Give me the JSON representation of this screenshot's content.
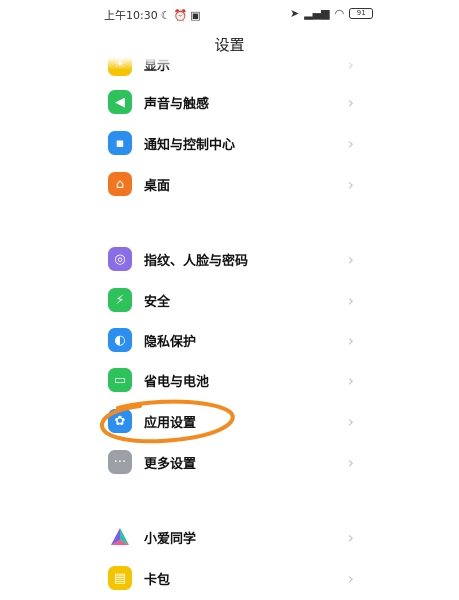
{
  "status": {
    "time": "上午10:30",
    "battery": "91"
  },
  "header": {
    "title": "设置"
  },
  "items": [
    {
      "label": "显示",
      "icon": "sun-icon",
      "color": "#f5c400"
    },
    {
      "label": "声音与触感",
      "icon": "speaker-icon",
      "color": "#2dc35a"
    },
    {
      "label": "通知与控制中心",
      "icon": "notification-icon",
      "color": "#2a8ff0"
    },
    {
      "label": "桌面",
      "icon": "home-icon",
      "color": "#f2761f"
    },
    {
      "label": "指纹、人脸与密码",
      "icon": "fingerprint-icon",
      "color": "#8a6ee8"
    },
    {
      "label": "安全",
      "icon": "shield-icon",
      "color": "#2dc35a"
    },
    {
      "label": "隐私保护",
      "icon": "privacy-icon",
      "color": "#2a8ff0"
    },
    {
      "label": "省电与电池",
      "icon": "battery-icon",
      "color": "#2dc35a"
    },
    {
      "label": "应用设置",
      "icon": "gear-icon",
      "color": "#2a8ff0"
    },
    {
      "label": "更多设置",
      "icon": "more-icon",
      "color": "#9aa0a6"
    },
    {
      "label": "小爱同学",
      "icon": "xiaoai-icon",
      "color": "#ffffff"
    },
    {
      "label": "卡包",
      "icon": "wallet-icon",
      "color": "#f5c400"
    }
  ],
  "annotation": {
    "color": "#f28a1e"
  }
}
